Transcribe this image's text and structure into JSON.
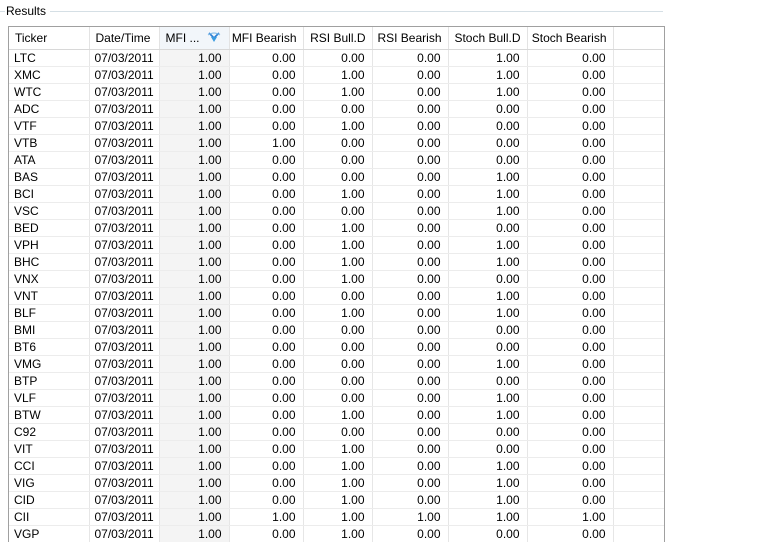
{
  "group": {
    "title": "Results"
  },
  "columns": [
    {
      "key": "ticker",
      "label": "Ticker"
    },
    {
      "key": "date",
      "label": "Date/Time"
    },
    {
      "key": "mfi",
      "label": "MFI ..."
    },
    {
      "key": "mfi_bearish",
      "label": "MFI Bearish"
    },
    {
      "key": "rsi_bull",
      "label": "RSI Bull.D"
    },
    {
      "key": "rsi_bearish",
      "label": "RSI Bearish"
    },
    {
      "key": "stoch_bull",
      "label": "Stoch Bull.D"
    },
    {
      "key": "stoch_bearish",
      "label": "Stoch Bearish"
    }
  ],
  "sort_icon": "sort-descending-icon",
  "rows": [
    [
      "LTC",
      "07/03/2011",
      "1.00",
      "0.00",
      "0.00",
      "0.00",
      "1.00",
      "0.00"
    ],
    [
      "XMC",
      "07/03/2011",
      "1.00",
      "0.00",
      "1.00",
      "0.00",
      "1.00",
      "0.00"
    ],
    [
      "WTC",
      "07/03/2011",
      "1.00",
      "0.00",
      "1.00",
      "0.00",
      "1.00",
      "0.00"
    ],
    [
      "ADC",
      "07/03/2011",
      "1.00",
      "0.00",
      "0.00",
      "0.00",
      "0.00",
      "0.00"
    ],
    [
      "VTF",
      "07/03/2011",
      "1.00",
      "0.00",
      "1.00",
      "0.00",
      "0.00",
      "0.00"
    ],
    [
      "VTB",
      "07/03/2011",
      "1.00",
      "1.00",
      "0.00",
      "0.00",
      "0.00",
      "0.00"
    ],
    [
      "ATA",
      "07/03/2011",
      "1.00",
      "0.00",
      "0.00",
      "0.00",
      "0.00",
      "0.00"
    ],
    [
      "BAS",
      "07/03/2011",
      "1.00",
      "0.00",
      "0.00",
      "0.00",
      "1.00",
      "0.00"
    ],
    [
      "BCI",
      "07/03/2011",
      "1.00",
      "0.00",
      "1.00",
      "0.00",
      "1.00",
      "0.00"
    ],
    [
      "VSC",
      "07/03/2011",
      "1.00",
      "0.00",
      "0.00",
      "0.00",
      "1.00",
      "0.00"
    ],
    [
      "BED",
      "07/03/2011",
      "1.00",
      "0.00",
      "1.00",
      "0.00",
      "0.00",
      "0.00"
    ],
    [
      "VPH",
      "07/03/2011",
      "1.00",
      "0.00",
      "1.00",
      "0.00",
      "1.00",
      "0.00"
    ],
    [
      "BHC",
      "07/03/2011",
      "1.00",
      "0.00",
      "1.00",
      "0.00",
      "1.00",
      "0.00"
    ],
    [
      "VNX",
      "07/03/2011",
      "1.00",
      "0.00",
      "1.00",
      "0.00",
      "0.00",
      "0.00"
    ],
    [
      "VNT",
      "07/03/2011",
      "1.00",
      "0.00",
      "0.00",
      "0.00",
      "1.00",
      "0.00"
    ],
    [
      "BLF",
      "07/03/2011",
      "1.00",
      "0.00",
      "1.00",
      "0.00",
      "1.00",
      "0.00"
    ],
    [
      "BMI",
      "07/03/2011",
      "1.00",
      "0.00",
      "0.00",
      "0.00",
      "0.00",
      "0.00"
    ],
    [
      "BT6",
      "07/03/2011",
      "1.00",
      "0.00",
      "0.00",
      "0.00",
      "0.00",
      "0.00"
    ],
    [
      "VMG",
      "07/03/2011",
      "1.00",
      "0.00",
      "0.00",
      "0.00",
      "1.00",
      "0.00"
    ],
    [
      "BTP",
      "07/03/2011",
      "1.00",
      "0.00",
      "0.00",
      "0.00",
      "0.00",
      "0.00"
    ],
    [
      "VLF",
      "07/03/2011",
      "1.00",
      "0.00",
      "0.00",
      "0.00",
      "1.00",
      "0.00"
    ],
    [
      "BTW",
      "07/03/2011",
      "1.00",
      "0.00",
      "1.00",
      "0.00",
      "1.00",
      "0.00"
    ],
    [
      "C92",
      "07/03/2011",
      "1.00",
      "0.00",
      "0.00",
      "0.00",
      "0.00",
      "0.00"
    ],
    [
      "VIT",
      "07/03/2011",
      "1.00",
      "0.00",
      "1.00",
      "0.00",
      "0.00",
      "0.00"
    ],
    [
      "CCI",
      "07/03/2011",
      "1.00",
      "0.00",
      "1.00",
      "0.00",
      "1.00",
      "0.00"
    ],
    [
      "VIG",
      "07/03/2011",
      "1.00",
      "0.00",
      "1.00",
      "0.00",
      "1.00",
      "0.00"
    ],
    [
      "CID",
      "07/03/2011",
      "1.00",
      "0.00",
      "1.00",
      "0.00",
      "1.00",
      "0.00"
    ],
    [
      "CII",
      "07/03/2011",
      "1.00",
      "1.00",
      "1.00",
      "1.00",
      "1.00",
      "1.00"
    ],
    [
      "VGP",
      "07/03/2011",
      "1.00",
      "0.00",
      "1.00",
      "0.00",
      "0.00",
      "0.00"
    ]
  ]
}
